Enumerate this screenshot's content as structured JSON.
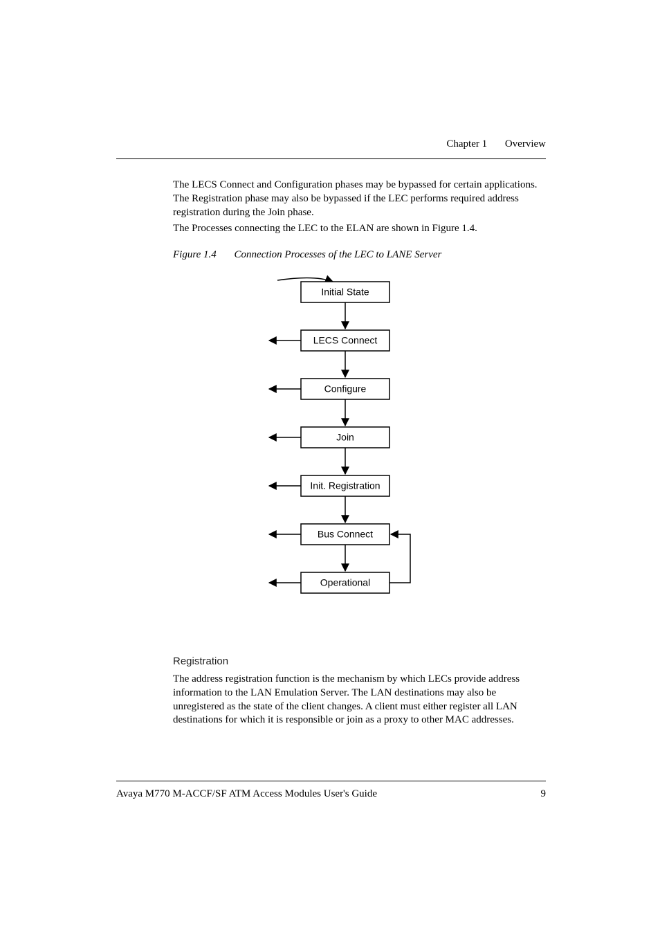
{
  "header": {
    "chapter": "Chapter 1",
    "title": "Overview"
  },
  "paragraphs": {
    "p1": "The LECS Connect and Configuration phases may be bypassed for certain applications. The Registration phase may also be bypassed if the LEC performs required address registration during the Join phase.",
    "p2": "The Processes connecting the LEC to the ELAN are shown in Figure 1.4."
  },
  "figure": {
    "label": "Figure 1.4",
    "caption": "Connection Processes of the LEC to LANE Server"
  },
  "chart_data": {
    "type": "flowchart",
    "nodes": [
      {
        "id": "initial",
        "label": "Initial State"
      },
      {
        "id": "lecs",
        "label": "LECS Connect"
      },
      {
        "id": "configure",
        "label": "Configure"
      },
      {
        "id": "join",
        "label": "Join"
      },
      {
        "id": "initreg",
        "label": "Init. Registration"
      },
      {
        "id": "bus",
        "label": "Bus Connect"
      },
      {
        "id": "operational",
        "label": "Operational"
      }
    ],
    "edges_forward": [
      [
        "initial",
        "lecs"
      ],
      [
        "lecs",
        "configure"
      ],
      [
        "configure",
        "join"
      ],
      [
        "join",
        "initreg"
      ],
      [
        "initreg",
        "bus"
      ],
      [
        "bus",
        "operational"
      ]
    ],
    "entry_edge_into": "initial",
    "left_back_edges_from": [
      "lecs",
      "configure",
      "join",
      "initreg",
      "bus",
      "operational"
    ],
    "right_back_edge": {
      "from": "operational",
      "to": "bus",
      "note": "Operational can loop back to Bus Connect (right-side arrow)"
    }
  },
  "section": {
    "heading": "Registration",
    "body": "The address registration function is the mechanism by which LECs provide address information to the LAN Emulation Server. The LAN destinations may also be unregistered as the state of the client changes. A client must either register all LAN destinations for which it is responsible or join as a proxy to other MAC addresses."
  },
  "footer": {
    "doc_title": "Avaya M770 M-ACCF/SF ATM Access Modules User's Guide",
    "page_number": "9"
  }
}
